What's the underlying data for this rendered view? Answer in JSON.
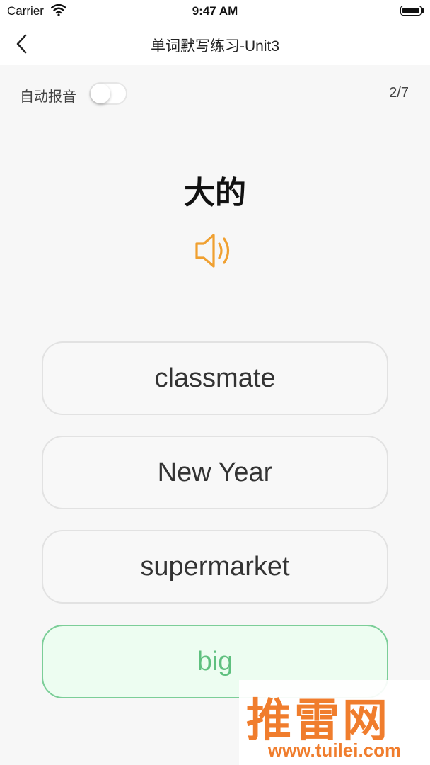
{
  "status_bar": {
    "carrier": "Carrier",
    "time": "9:47 AM"
  },
  "nav": {
    "title": "单词默写练习-Unit3"
  },
  "settings": {
    "auto_play_label": "自动报音",
    "auto_play_enabled": false,
    "progress": "2/7"
  },
  "question": {
    "word": "大的",
    "speaker_icon": "speaker-icon"
  },
  "options": [
    {
      "label": "classmate",
      "state": "normal"
    },
    {
      "label": "New Year",
      "state": "normal"
    },
    {
      "label": "supermarket",
      "state": "normal"
    },
    {
      "label": "big",
      "state": "correct"
    }
  ],
  "watermark": {
    "brand": "推雷网",
    "url": "www.tuilei.com"
  },
  "colors": {
    "accent": "#f0a030",
    "correct_border": "#7cce98",
    "correct_bg": "#edfdf1",
    "correct_text": "#5fc07f",
    "watermark": "#f07d2d"
  }
}
